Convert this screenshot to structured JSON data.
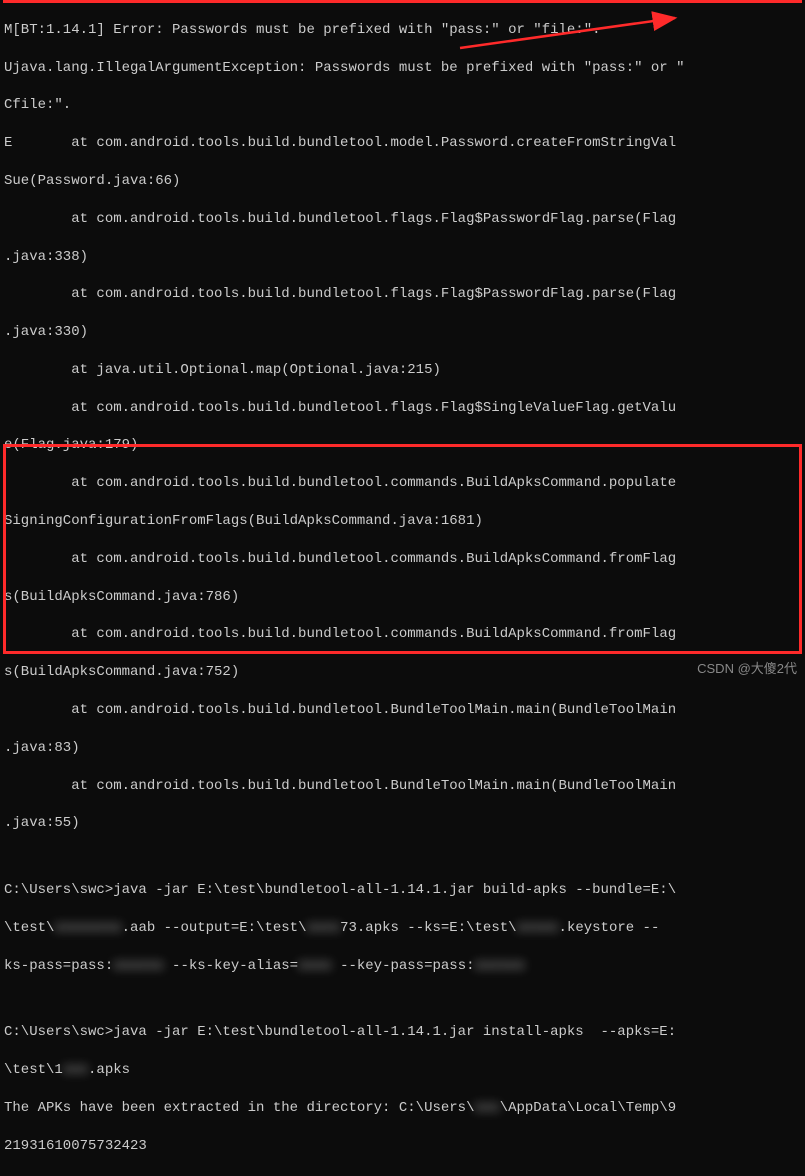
{
  "stack": {
    "l0": "M[BT:1.14.1] Error: Passwords must be prefixed with \"pass:\" or \"file:\".",
    "l1": "Ujava.lang.IllegalArgumentException: Passwords must be prefixed with \"pass:\" or \"",
    "l2": "Cfile:\".",
    "l3": "E       at com.android.tools.build.bundletool.model.Password.createFromStringVal",
    "l4": "Sue(Password.java:66)",
    "l5": "        at com.android.tools.build.bundletool.flags.Flag$PasswordFlag.parse(Flag",
    "l6": ".java:338)",
    "l7": "        at com.android.tools.build.bundletool.flags.Flag$PasswordFlag.parse(Flag",
    "l8": ".java:330)",
    "l9": "        at java.util.Optional.map(Optional.java:215)",
    "l10": "        at com.android.tools.build.bundletool.flags.Flag$SingleValueFlag.getValu",
    "l11": "e(Flag.java:179)",
    "l12": "        at com.android.tools.build.bundletool.commands.BuildApksCommand.populate",
    "l13": "SigningConfigurationFromFlags(BuildApksCommand.java:1681)",
    "l14": "        at com.android.tools.build.bundletool.commands.BuildApksCommand.fromFlag",
    "l15": "s(BuildApksCommand.java:786)",
    "l16": "        at com.android.tools.build.bundletool.commands.BuildApksCommand.fromFlag",
    "l17": "s(BuildApksCommand.java:752)",
    "l18": "        at com.android.tools.build.bundletool.BundleToolMain.main(BundleToolMain",
    "l19": ".java:83)",
    "l20": "        at com.android.tools.build.bundletool.BundleToolMain.main(BundleToolMain",
    "l21": ".java:55)"
  },
  "cmd1": {
    "prefix": "C:\\Users\\swc>java -jar E:\\test\\bundletool-all-1.14.1.jar build-apks --bundle=E:\\",
    "part2a": "\\test\\",
    "part2b": ".aab --output=E:\\test\\",
    "part2c": "73.apks --ks=E:\\test\\",
    "part2d": ".keystore --",
    "part3a": "ks-pass=pass:",
    "part3b": " --ks-key-alias=",
    "part3c": " --key-pass=pass:",
    "redact1": "xxxxxxxx",
    "redact2": "xxxx",
    "redact3": "xxxxx",
    "redact4": "xxxxxx",
    "redact5": "xxxx",
    "redact6": "xxxxxx"
  },
  "cmd2": {
    "l1": "C:\\Users\\swc>java -jar E:\\test\\bundletool-all-1.14.1.jar install-apks  --apks=E:",
    "l2a": "\\test\\1",
    "l2b": ".apks",
    "redact": "xxx"
  },
  "result": {
    "l1a": "The APKs have been extracted in the directory: C:\\Users\\",
    "l1b": "\\AppData\\Local\\Temp\\9",
    "l2": "21931610075732423",
    "redact": "xxx"
  },
  "watermark": "CSDN @大傻2代"
}
